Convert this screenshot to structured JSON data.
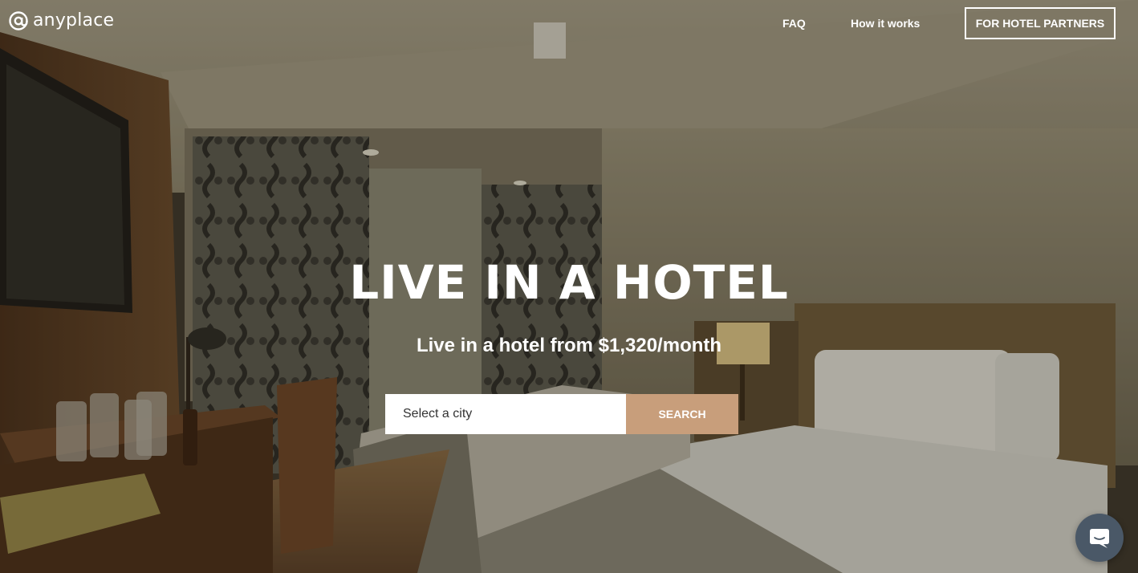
{
  "brand": {
    "name": "anyplace",
    "accent_color": "#c89e7b"
  },
  "nav": {
    "faq_label": "FAQ",
    "how_label": "How it works",
    "partners_label": "FOR HOTEL PARTNERS"
  },
  "hero": {
    "title": "LIVE IN A HOTEL",
    "subtitle": "Live in a hotel from $1,320/month",
    "background": "hotel-room-photo"
  },
  "search": {
    "placeholder": "Select a city",
    "value": "",
    "button_label": "SEARCH"
  },
  "chat": {
    "icon": "chat-bubble-icon",
    "color": "#4a5867"
  }
}
